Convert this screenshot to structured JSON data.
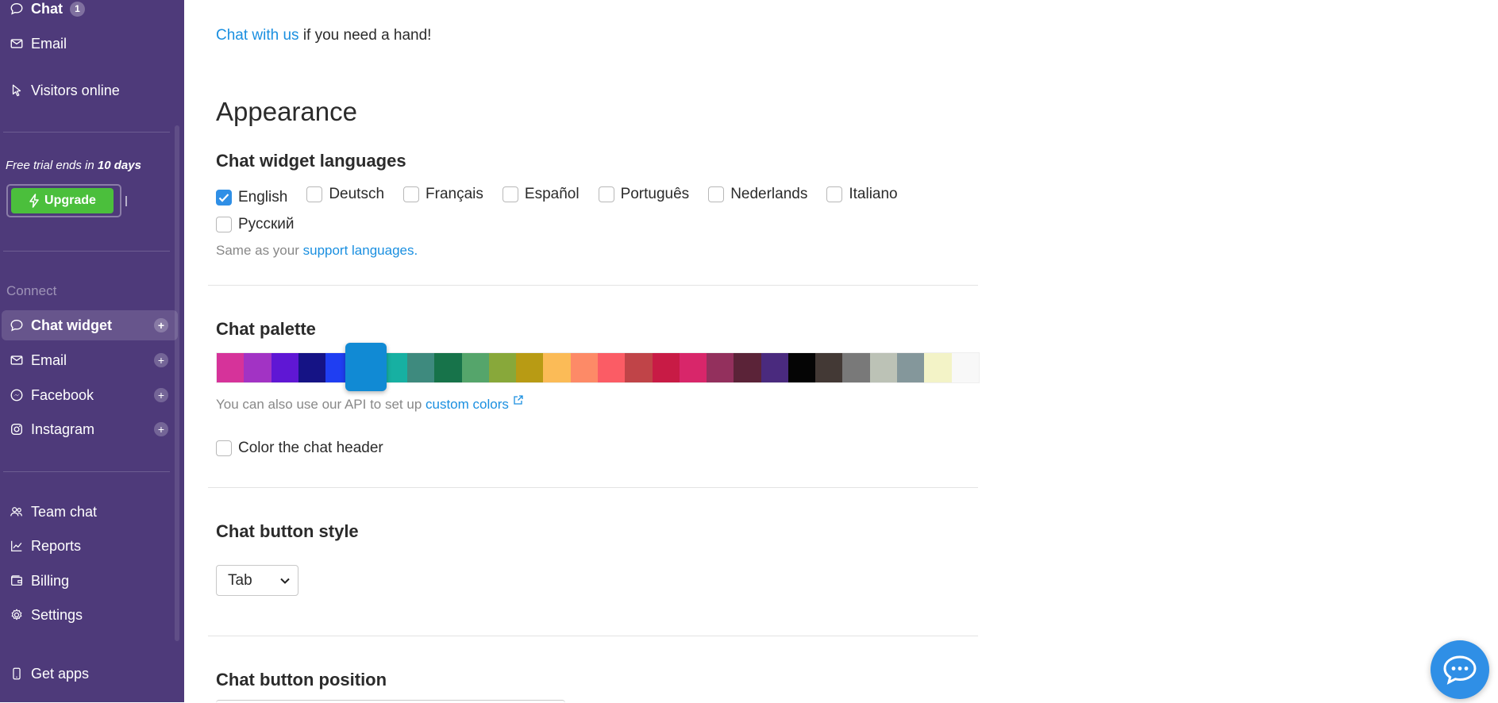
{
  "sidebar": {
    "top_items": [
      {
        "label": "Chat",
        "badge": "1",
        "icon": "chat-bubble-icon"
      },
      {
        "label": "Email",
        "icon": "envelope-icon"
      },
      {
        "label": "Visitors online",
        "icon": "cursor-icon"
      }
    ],
    "trial": {
      "prefix": "Free trial ends in ",
      "days": "10 days"
    },
    "upgrade_label": "Upgrade",
    "section_label": "Connect",
    "connect_items": [
      {
        "label": "Chat widget",
        "icon": "chat-bubble-icon",
        "active": true
      },
      {
        "label": "Email",
        "icon": "envelope-icon"
      },
      {
        "label": "Facebook",
        "icon": "messenger-icon"
      },
      {
        "label": "Instagram",
        "icon": "instagram-icon"
      }
    ],
    "bottom_items": [
      {
        "label": "Team chat",
        "icon": "team-icon"
      },
      {
        "label": "Reports",
        "icon": "chart-icon"
      },
      {
        "label": "Billing",
        "icon": "wallet-icon"
      },
      {
        "label": "Settings",
        "icon": "gear-icon"
      },
      {
        "label": "Get apps",
        "icon": "phone-icon"
      }
    ]
  },
  "main": {
    "help": {
      "link": "Chat with us",
      "text": " if you need a hand!"
    },
    "appearance_title": "Appearance",
    "languages": {
      "title": "Chat widget languages",
      "options": [
        {
          "label": "English",
          "checked": true
        },
        {
          "label": "Deutsch",
          "checked": false
        },
        {
          "label": "Français",
          "checked": false
        },
        {
          "label": "Español",
          "checked": false
        },
        {
          "label": "Português",
          "checked": false
        },
        {
          "label": "Nederlands",
          "checked": false
        },
        {
          "label": "Italiano",
          "checked": false
        },
        {
          "label": "Русский",
          "checked": false
        }
      ],
      "hint_prefix": "Same as your ",
      "hint_link": "support languages",
      "hint_suffix": "."
    },
    "palette": {
      "title": "Chat palette",
      "colors": [
        "#d6339a",
        "#a233c4",
        "#5f17d4",
        "#151385",
        "#1f3ef2",
        "#118ad4",
        "#17b0a2",
        "#3e8a7e",
        "#17734a",
        "#55a56b",
        "#88a83a",
        "#b89b14",
        "#fbbb57",
        "#fd8a67",
        "#fb5c65",
        "#c04448",
        "#c81b45",
        "#d8266a",
        "#93305d",
        "#5b2338",
        "#4a2a7e",
        "#050505",
        "#433935",
        "#797979",
        "#bcc2b6",
        "#84979b",
        "#f3f3c7",
        "#f8f8f8"
      ],
      "selected_color": "#118ad4",
      "hint_prefix": "You can also use our API to set up ",
      "hint_link": "custom colors"
    },
    "color_header": {
      "label": "Color the chat header",
      "checked": false
    },
    "button_style": {
      "title": "Chat button style",
      "value": "Tab"
    },
    "button_position": {
      "title": "Chat button position"
    }
  },
  "launcher": {
    "icon": "chat-launcher-icon"
  }
}
